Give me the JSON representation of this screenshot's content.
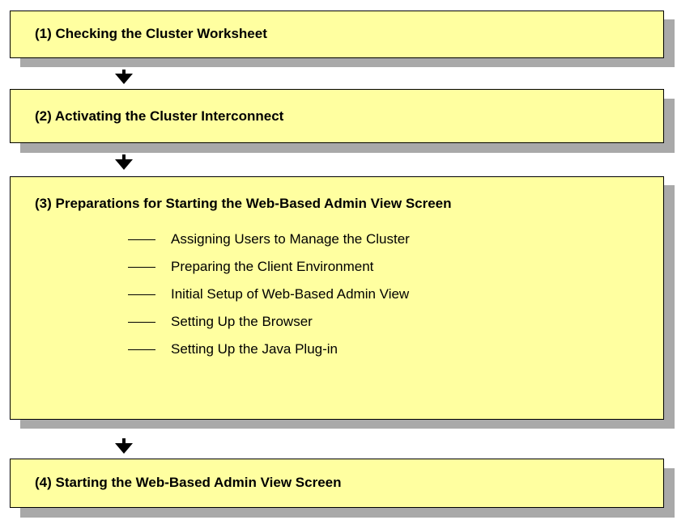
{
  "steps": [
    {
      "title": "(1) Checking the Cluster Worksheet"
    },
    {
      "title": "(2) Activating the Cluster Interconnect"
    },
    {
      "title": "(3) Preparations for Starting the Web-Based Admin View Screen",
      "substeps": [
        "Assigning Users to Manage the Cluster",
        "Preparing the Client Environment",
        "Initial Setup of Web-Based Admin View",
        "Setting Up the Browser",
        "Setting Up the Java Plug-in"
      ]
    },
    {
      "title": "(4) Starting the Web-Based Admin View Screen"
    }
  ],
  "colors": {
    "box_fill": "#ffffa0",
    "shadow": "#a9a9a9",
    "border": "#000000"
  }
}
